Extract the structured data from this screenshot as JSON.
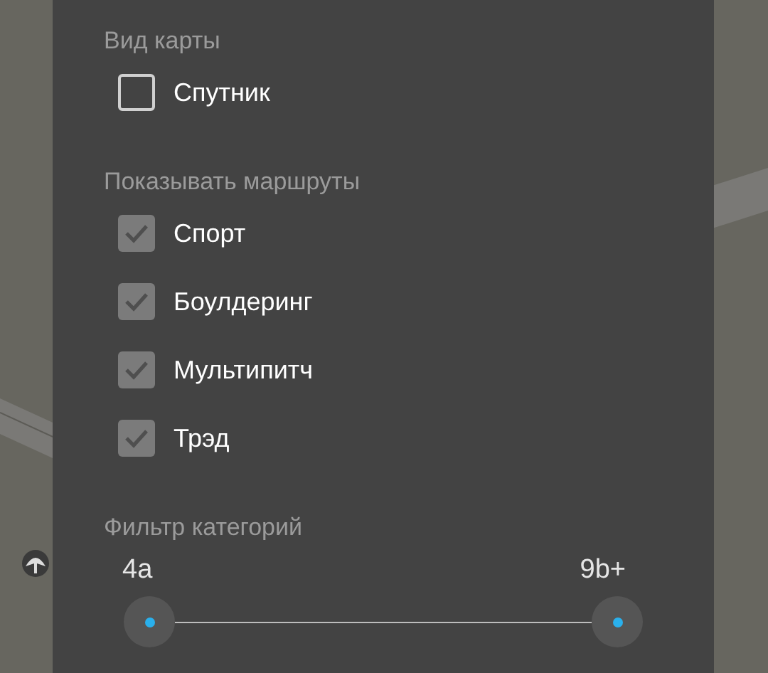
{
  "sections": [
    {
      "title": "Вид карты",
      "options": [
        {
          "label": "Спутник",
          "checked": false
        }
      ]
    },
    {
      "title": "Показывать маршруты",
      "options": [
        {
          "label": "Спорт",
          "checked": true
        },
        {
          "label": "Боулдеринг",
          "checked": true
        },
        {
          "label": "Мультипитч",
          "checked": true
        },
        {
          "label": "Трэд",
          "checked": true
        }
      ]
    }
  ],
  "grade_filter": {
    "title": "Фильтр категорий",
    "min_label": "4a",
    "max_label": "9b+"
  }
}
